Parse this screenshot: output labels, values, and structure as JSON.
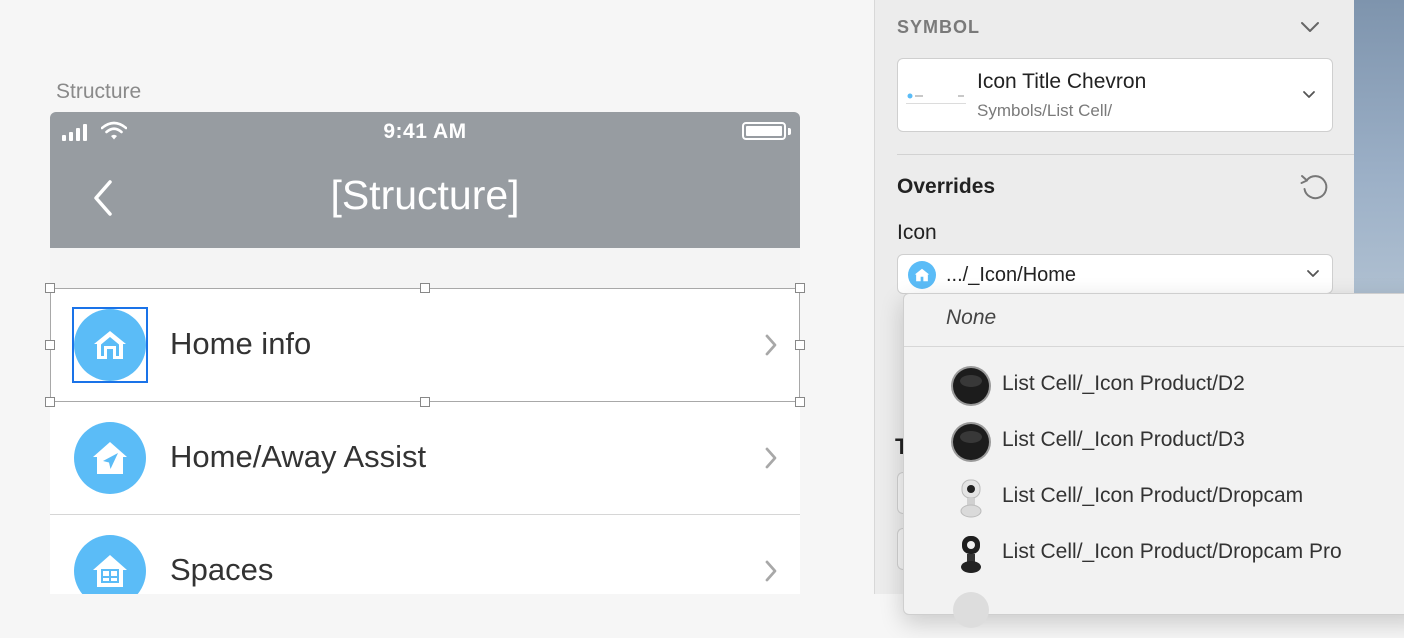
{
  "canvas": {
    "artboard_title": "Structure",
    "status_bar": {
      "time": "9:41 AM"
    },
    "nav": {
      "title": "[Structure]"
    },
    "cells": [
      {
        "label": "Home info",
        "icon": "home-icon"
      },
      {
        "label": "Home/Away Assist",
        "icon": "home-away-icon"
      },
      {
        "label": "Spaces",
        "icon": "spaces-icon"
      }
    ]
  },
  "inspector": {
    "symbol_section": "SYMBOL",
    "symbol": {
      "name": "Icon Title Chevron",
      "path": "Symbols/List Cell/"
    },
    "overrides_title": "Overrides",
    "icon_label": "Icon",
    "icon_value": ".../_Icon/Home",
    "hidden_label": "T"
  },
  "menu": {
    "none_label": "None",
    "items": [
      {
        "label": "List Cell/_Icon Product/D2",
        "icon": "d2-device-icon"
      },
      {
        "label": "List Cell/_Icon Product/D3",
        "icon": "d3-device-icon"
      },
      {
        "label": "List Cell/_Icon Product/Dropcam",
        "icon": "dropcam-icon"
      },
      {
        "label": "List Cell/_Icon Product/Dropcam Pro",
        "icon": "dropcam-pro-icon"
      }
    ]
  },
  "colors": {
    "accent": "#5bbcf7",
    "selection": "#1a73e8",
    "navbar": "#979ca1"
  }
}
